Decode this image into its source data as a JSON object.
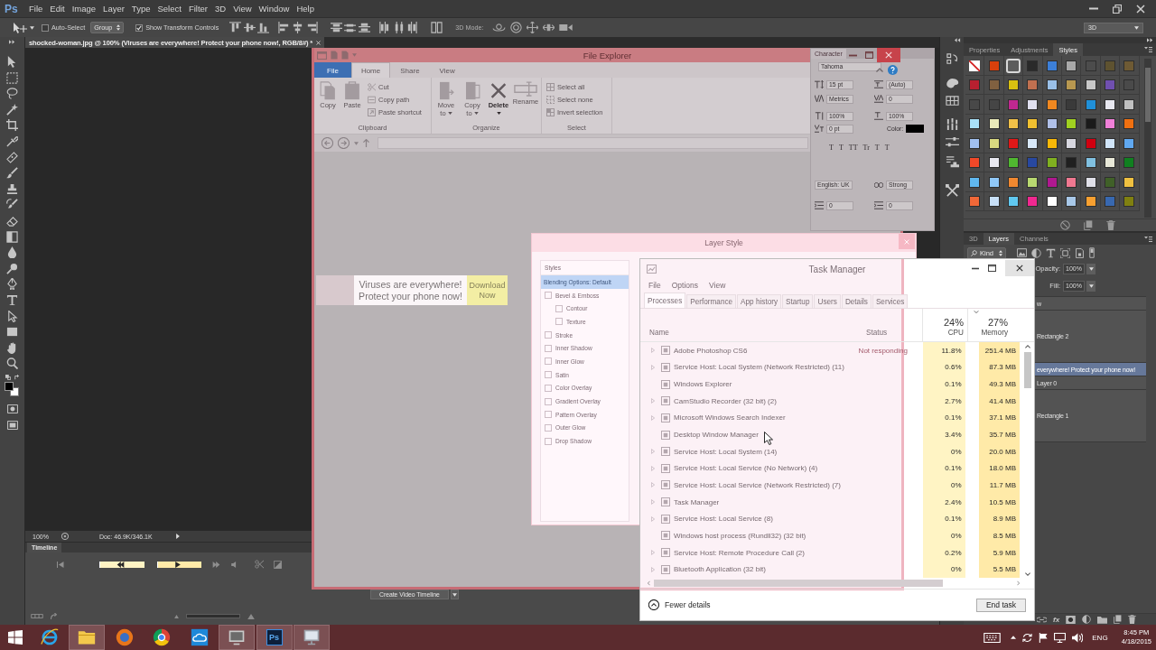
{
  "photoshop": {
    "logo": "Ps",
    "menu": [
      "File",
      "Edit",
      "Image",
      "Layer",
      "Type",
      "Select",
      "Filter",
      "3D",
      "View",
      "Window",
      "Help"
    ],
    "options_bar": {
      "auto_select": {
        "label": "Auto-Select",
        "checked": false
      },
      "target": "Group",
      "transform_controls": {
        "label": "Show Transform Controls",
        "checked": true
      },
      "mode_label": "3D Mode:",
      "workspace": "3D"
    },
    "document_tab": {
      "title": "shocked-woman.jpg @ 100% (Viruses are everywhere! Protect your phone now!, RGB/8#) *"
    },
    "foreground_color": {
      "color": "#000000"
    },
    "background_color": {
      "color": "#ffffff"
    },
    "banner": {
      "headline": "Viruses are everywhere! Protect your phone now!",
      "button": "Download Now"
    },
    "status_bar": {
      "zoom": "100%",
      "document": "Doc: 46.9K/346.1K"
    },
    "timeline": {
      "tab": "Timeline",
      "create_button": "Create Video Timeline"
    },
    "character_panel": {
      "tab": "Character",
      "font": "Tahoma",
      "size": "15 pt",
      "leading": "(Auto)",
      "kerning": "Metrics",
      "tracking": "0",
      "vertical_scale": "100%",
      "horizontal_scale": "100%",
      "baseline_shift": "0 pt",
      "color_label": "Color:",
      "color": "#000000",
      "style_buttons": [
        "T",
        "T",
        "TT",
        "Tr",
        "T",
        "T"
      ],
      "language": "English: UK",
      "anti_aliasing": "Strong",
      "indents": [
        "0",
        "0"
      ]
    },
    "styles_panel": {
      "tabs": [
        {
          "label": "Properties",
          "selected": false
        },
        {
          "label": "Adjustments",
          "selected": false
        },
        {
          "label": "Styles",
          "selected": true
        }
      ],
      "swatches": [
        {
          "kind": "none",
          "selected": false
        },
        {
          "kind": "color",
          "color": "#d8400c",
          "selected": false
        },
        {
          "kind": "color",
          "color": "#5c5c5c",
          "selected": true
        },
        {
          "kind": "color",
          "color": "#2a2a2a",
          "selected": false
        },
        {
          "kind": "color",
          "color": "#3c7fd8",
          "selected": false
        },
        {
          "kind": "color",
          "color": "#a8a8a8",
          "selected": false
        },
        {
          "kind": "color",
          "color": "#4c4c4c",
          "selected": false
        },
        {
          "kind": "color",
          "color": "#5e5230",
          "selected": false
        },
        {
          "kind": "color",
          "color": "#6e5a34",
          "selected": false
        },
        {
          "kind": "color",
          "color": "#b82030",
          "selected": false
        },
        {
          "kind": "color",
          "color": "#806040",
          "selected": false
        },
        {
          "kind": "color",
          "color": "#d8c010",
          "selected": false
        },
        {
          "kind": "color",
          "color": "#c07050",
          "selected": false
        },
        {
          "kind": "color",
          "color": "#9ac0e8",
          "selected": false
        },
        {
          "kind": "color",
          "color": "#b89850",
          "selected": false
        },
        {
          "kind": "color",
          "color": "#c8c8c8",
          "selected": false
        },
        {
          "kind": "color",
          "color": "#7050b0",
          "selected": false
        },
        {
          "kind": "color",
          "color": "#4a4a4a",
          "selected": false
        },
        {
          "kind": "color",
          "color": "#484848",
          "selected": false
        },
        {
          "kind": "color",
          "color": "#454545",
          "selected": false
        },
        {
          "kind": "color",
          "color": "#c02890",
          "selected": false
        },
        {
          "kind": "color",
          "color": "#e0e0f0",
          "selected": false
        },
        {
          "kind": "color",
          "color": "#f08820",
          "selected": false
        },
        {
          "kind": "color",
          "color": "#3a3a3a",
          "selected": false
        },
        {
          "kind": "color",
          "color": "#2090d8",
          "selected": false
        },
        {
          "kind": "color",
          "color": "#e8e8f0",
          "selected": false
        },
        {
          "kind": "color",
          "color": "#c0c0c0",
          "selected": false
        },
        {
          "kind": "color",
          "color": "#a8e0f8",
          "selected": false
        },
        {
          "kind": "color",
          "color": "#e8e8b8",
          "selected": false
        },
        {
          "kind": "color",
          "color": "#f0c048",
          "selected": false
        },
        {
          "kind": "color",
          "color": "#f0c030",
          "selected": false
        },
        {
          "kind": "color",
          "color": "#b0c0e8",
          "selected": false
        },
        {
          "kind": "color",
          "color": "#a0d020",
          "selected": false
        },
        {
          "kind": "color",
          "color": "#1a1a1a",
          "selected": false
        },
        {
          "kind": "color",
          "color": "#f080d8",
          "selected": false
        },
        {
          "kind": "color",
          "color": "#f07010",
          "selected": false
        },
        {
          "kind": "color",
          "color": "#a0c0f0",
          "selected": false
        },
        {
          "kind": "color",
          "color": "#d8d880",
          "selected": false
        },
        {
          "kind": "color",
          "color": "#e01818",
          "selected": false
        },
        {
          "kind": "color",
          "color": "#d8e8f8",
          "selected": false
        },
        {
          "kind": "color",
          "color": "#f8b808",
          "selected": false
        },
        {
          "kind": "color",
          "color": "#d8d8e0",
          "selected": false
        },
        {
          "kind": "color",
          "color": "#d00010",
          "selected": false
        },
        {
          "kind": "color",
          "color": "#d0e4f8",
          "selected": false
        },
        {
          "kind": "color",
          "color": "#60a8f0",
          "selected": false
        },
        {
          "kind": "color",
          "color": "#f04828",
          "selected": false
        },
        {
          "kind": "color",
          "color": "#e8e8f0",
          "selected": false
        },
        {
          "kind": "color",
          "color": "#50b830",
          "selected": false
        },
        {
          "kind": "color",
          "color": "#2848a0",
          "selected": false
        },
        {
          "kind": "color",
          "color": "#80b020",
          "selected": false
        },
        {
          "kind": "color",
          "color": "#202020",
          "selected": false
        },
        {
          "kind": "color",
          "color": "#80c0e0",
          "selected": false
        },
        {
          "kind": "color",
          "color": "#e8e8d8",
          "selected": false
        },
        {
          "kind": "color",
          "color": "#108020",
          "selected": false
        },
        {
          "kind": "color",
          "color": "#60b8f0",
          "selected": false
        },
        {
          "kind": "color",
          "color": "#90c8f8",
          "selected": false
        },
        {
          "kind": "color",
          "color": "#f08830",
          "selected": false
        },
        {
          "kind": "color",
          "color": "#b8d870",
          "selected": false
        },
        {
          "kind": "color",
          "color": "#b01890",
          "selected": false
        },
        {
          "kind": "color",
          "color": "#f07890",
          "selected": false
        },
        {
          "kind": "color",
          "color": "#e0e0e8",
          "selected": false
        },
        {
          "kind": "color",
          "color": "#406028",
          "selected": false
        },
        {
          "kind": "color",
          "color": "#f0c040",
          "selected": false
        },
        {
          "kind": "color",
          "color": "#f06838",
          "selected": false
        },
        {
          "kind": "color",
          "color": "#c8e0f8",
          "selected": false
        },
        {
          "kind": "color",
          "color": "#60c8f0",
          "selected": false
        },
        {
          "kind": "color",
          "color": "#f02890",
          "selected": false
        },
        {
          "kind": "color",
          "color": "#ffffff",
          "selected": false
        },
        {
          "kind": "color",
          "color": "#a8c8e8",
          "selected": false
        },
        {
          "kind": "color",
          "color": "#f8a030",
          "selected": false
        },
        {
          "kind": "color",
          "color": "#3868b0",
          "selected": false
        },
        {
          "kind": "color",
          "color": "#808010",
          "selected": false
        }
      ]
    },
    "layers_panel": {
      "tabs": [
        {
          "label": "3D",
          "selected": false
        },
        {
          "label": "Layers",
          "selected": true
        },
        {
          "label": "Channels",
          "selected": false
        }
      ],
      "filter": "Kind",
      "opacity_label": "Opacity:",
      "opacity": "100%",
      "fill_label": "Fill:",
      "fill": "100%",
      "layers": [
        {
          "name": "w",
          "kind": "text",
          "selected": false
        },
        {
          "name": "Rectangle 2",
          "kind": "shape",
          "selected": false
        },
        {
          "name": "everywhere! Protect your phone now!",
          "kind": "text",
          "selected": true
        },
        {
          "name": "Layer 0",
          "kind": "pixel",
          "selected": false
        },
        {
          "name": "Rectangle 1",
          "kind": "shape",
          "selected": false
        }
      ],
      "effects_button": "fx"
    }
  },
  "file_explorer": {
    "title": "File Explorer",
    "tabs": [
      {
        "label": "File",
        "kind": "menu",
        "selected": false
      },
      {
        "label": "Home",
        "kind": "tab",
        "selected": true
      },
      {
        "label": "Share",
        "kind": "tab",
        "selected": false
      },
      {
        "label": "View",
        "kind": "tab",
        "selected": false
      }
    ],
    "groups": [
      {
        "label": "Clipboard",
        "buttons": [
          {
            "label": "Copy",
            "dropdown": false,
            "disabled": true
          },
          {
            "label": "Paste",
            "dropdown": false,
            "disabled": true
          }
        ],
        "commands": [
          "Cut",
          "Copy path",
          "Paste shortcut"
        ]
      },
      {
        "label": "Organize",
        "buttons": [
          {
            "label": "Move to",
            "dropdown": true,
            "disabled": true
          },
          {
            "label": "Copy to",
            "dropdown": true,
            "disabled": true
          },
          {
            "label": "Delete",
            "dropdown": true,
            "disabled": false
          },
          {
            "label": "Rename",
            "dropdown": false,
            "disabled": true
          }
        ]
      },
      {
        "label": "Select",
        "commands": [
          "Select all",
          "Select none",
          "Invert selection"
        ]
      }
    ]
  },
  "layer_style": {
    "title": "Layer Style",
    "list_header": "Styles",
    "blending": {
      "label": "Blending Options: Default",
      "selected": true
    },
    "effects": [
      {
        "label": "Bevel & Emboss",
        "checked": false,
        "selected": false,
        "children": [
          {
            "label": "Contour",
            "checked": false,
            "selected": false
          },
          {
            "label": "Texture",
            "checked": false,
            "selected": false
          }
        ]
      },
      {
        "label": "Stroke",
        "checked": false,
        "selected": false
      },
      {
        "label": "Inner Shadow",
        "checked": false,
        "selected": false
      },
      {
        "label": "Inner Glow",
        "checked": false,
        "selected": false
      },
      {
        "label": "Satin",
        "checked": false,
        "selected": false
      },
      {
        "label": "Color Overlay",
        "checked": false,
        "selected": false
      },
      {
        "label": "Gradient Overlay",
        "checked": false,
        "selected": false
      },
      {
        "label": "Pattern Overlay",
        "checked": false,
        "selected": false
      },
      {
        "label": "Outer Glow",
        "checked": false,
        "selected": false
      },
      {
        "label": "Drop Shadow",
        "checked": false,
        "selected": false
      }
    ]
  },
  "task_manager": {
    "title": "Task Manager",
    "menu": [
      "File",
      "Options",
      "View"
    ],
    "tabs": [
      {
        "label": "Processes",
        "selected": true
      },
      {
        "label": "Performance",
        "selected": false
      },
      {
        "label": "App history",
        "selected": false
      },
      {
        "label": "Startup",
        "selected": false
      },
      {
        "label": "Users",
        "selected": false
      },
      {
        "label": "Details",
        "selected": false
      },
      {
        "label": "Services",
        "selected": false
      }
    ],
    "columns": [
      {
        "label": "Name",
        "sorted": false
      },
      {
        "label": "Status",
        "sorted": false
      },
      {
        "total": "24%",
        "label": "CPU",
        "sorted": false
      },
      {
        "total": "27%",
        "label": "Memory",
        "sorted": true
      }
    ],
    "rows": [
      {
        "name": "Adobe Photoshop CS6",
        "expandable": true,
        "status": "Not responding",
        "cpu": "11.8%",
        "memory": "251.4 MB"
      },
      {
        "name": "Service Host: Local System (Network Restricted) (11)",
        "expandable": true,
        "cpu": "0.6%",
        "memory": "87.3 MB"
      },
      {
        "name": "Windows Explorer",
        "expandable": false,
        "cpu": "0.1%",
        "memory": "49.3 MB"
      },
      {
        "name": "CamStudio Recorder (32 bit) (2)",
        "expandable": true,
        "cpu": "2.7%",
        "memory": "41.4 MB"
      },
      {
        "name": "Microsoft Windows Search Indexer",
        "expandable": true,
        "cpu": "0.1%",
        "memory": "37.1 MB"
      },
      {
        "name": "Desktop Window Manager",
        "expandable": false,
        "cpu": "3.4%",
        "memory": "35.7 MB"
      },
      {
        "name": "Service Host: Local System (14)",
        "expandable": true,
        "cpu": "0%",
        "memory": "20.0 MB"
      },
      {
        "name": "Service Host: Local Service (No Network) (4)",
        "expandable": true,
        "cpu": "0.1%",
        "memory": "18.0 MB"
      },
      {
        "name": "Service Host: Local Service (Network Restricted) (7)",
        "expandable": true,
        "cpu": "0%",
        "memory": "11.7 MB"
      },
      {
        "name": "Task Manager",
        "expandable": true,
        "cpu": "2.4%",
        "memory": "10.5 MB"
      },
      {
        "name": "Service Host: Local Service (8)",
        "expandable": true,
        "cpu": "0.1%",
        "memory": "8.9 MB"
      },
      {
        "name": "Windows host process (Rundll32) (32 bit)",
        "expandable": false,
        "cpu": "0%",
        "memory": "8.5 MB"
      },
      {
        "name": "Service Host: Remote Procedure Call (2)",
        "expandable": true,
        "cpu": "0.2%",
        "memory": "5.9 MB"
      },
      {
        "name": "Bluetooth Application (32 bit)",
        "expandable": true,
        "cpu": "0%",
        "memory": "5.5 MB"
      }
    ],
    "footer": {
      "toggle": "Fewer details",
      "button": "End task"
    }
  },
  "taskbar": {
    "apps": [
      {
        "kind": "e-browser",
        "active": false
      },
      {
        "kind": "folder",
        "active": true
      },
      {
        "kind": "fox-browser",
        "active": false
      },
      {
        "kind": "ball-browser",
        "active": false
      },
      {
        "kind": "cloud",
        "active": false
      },
      {
        "kind": "recorder",
        "active": true
      },
      {
        "kind": "tile",
        "label": "Ps",
        "active": true
      },
      {
        "kind": "monitor",
        "active": true
      }
    ],
    "tray": {
      "language": "ENG",
      "time": "8:45 PM",
      "date": "4/18/2015"
    }
  }
}
